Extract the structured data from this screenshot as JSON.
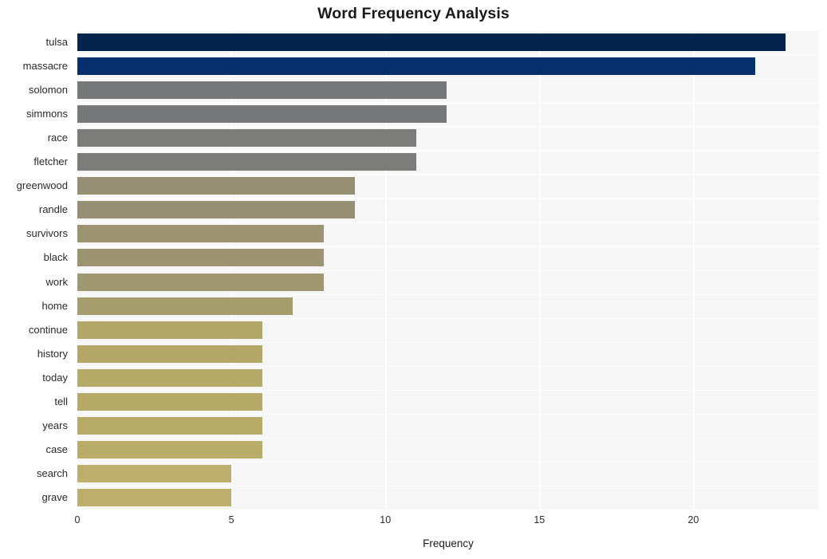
{
  "chart_data": {
    "type": "bar",
    "orientation": "horizontal",
    "title": "Word Frequency Analysis",
    "xlabel": "Frequency",
    "ylabel": "",
    "categories": [
      "tulsa",
      "massacre",
      "solomon",
      "simmons",
      "race",
      "fletcher",
      "greenwood",
      "randle",
      "survivors",
      "black",
      "work",
      "home",
      "continue",
      "history",
      "today",
      "tell",
      "years",
      "case",
      "search",
      "grave"
    ],
    "values": [
      23,
      22,
      12,
      12,
      11,
      11,
      9,
      9,
      8,
      8,
      8,
      7,
      6,
      6,
      6,
      6,
      6,
      6,
      5,
      5
    ],
    "bar_colors": [
      "#04244e",
      "#05306b",
      "#77787a",
      "#77787a",
      "#7c7c7b",
      "#7c7c7b",
      "#968f74",
      "#968f74",
      "#9b9371",
      "#9b9371",
      "#9f976f",
      "#a69d6c",
      "#b2a668",
      "#b3a667",
      "#b5a967",
      "#b6a967",
      "#b8ab68",
      "#b9ac68",
      "#bdae6b",
      "#bdae6b"
    ],
    "xlim": [
      0,
      24.08
    ],
    "xticks": [
      0,
      5,
      10,
      15,
      20
    ],
    "xtick_labels": [
      "0",
      "5",
      "10",
      "15",
      "20"
    ],
    "grid": true,
    "grid_color": "#ffffff",
    "plot_background": "#f6f6f7",
    "figure_background": "#ffffff",
    "legend": null
  }
}
